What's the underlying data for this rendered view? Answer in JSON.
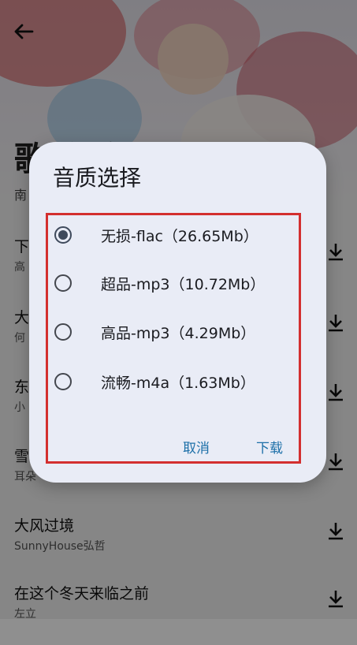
{
  "header": {
    "back_icon": "arrow-left-icon"
  },
  "album": {
    "title": "歌单·冬天",
    "subtitle": "南"
  },
  "songs": [
    {
      "name": "下",
      "artist": "高"
    },
    {
      "name": "大",
      "artist": "何"
    },
    {
      "name": "东",
      "artist": "小"
    },
    {
      "name": "雪",
      "artist": "耳朵"
    },
    {
      "name": "大风过境",
      "artist": "SunnyHouse弘哲"
    },
    {
      "name": "在这个冬天来临之前",
      "artist": "左立"
    }
  ],
  "dialog": {
    "title": "音质选择",
    "options": [
      {
        "label": "无损-flac（26.65Mb）",
        "selected": true
      },
      {
        "label": "超品-mp3（10.72Mb）",
        "selected": false
      },
      {
        "label": "高品-mp3（4.29Mb）",
        "selected": false
      },
      {
        "label": "流畅-m4a（1.63Mb）",
        "selected": false
      }
    ],
    "cancel_label": "取消",
    "download_label": "下载"
  },
  "colors": {
    "accent": "#1c6fa8",
    "highlight": "#d32f2f",
    "dialog_bg": "#e9ecf6"
  }
}
